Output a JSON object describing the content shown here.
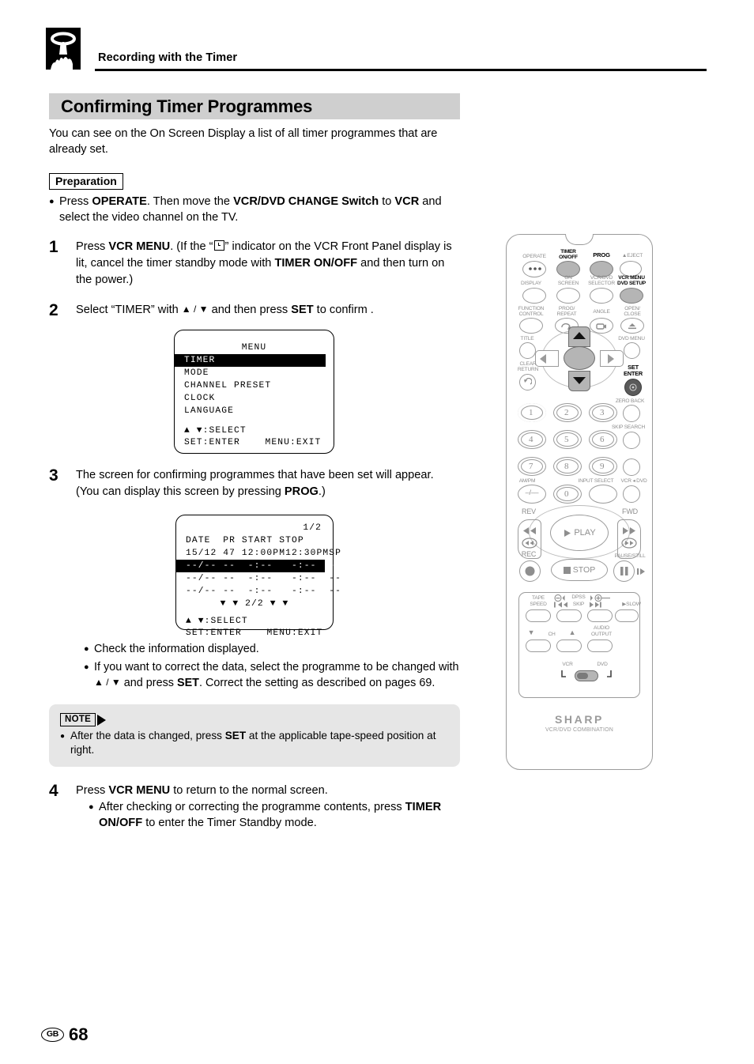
{
  "header": {
    "icon": "finger-press-icon",
    "title": "Recording with the Timer"
  },
  "section": {
    "title": "Confirming Timer Programmes",
    "intro": "You can see on the On Screen Display a list of all timer programmes that are already set."
  },
  "preparation": {
    "label": "Preparation",
    "bullet_prefix": "Press ",
    "bullet_b1": "OPERATE",
    "bullet_mid1": ". Then move the ",
    "bullet_b2": "VCR/DVD CHANGE Switch",
    "bullet_mid2": " to ",
    "bullet_b3": "VCR",
    "bullet_end": " and select the video channel on the TV."
  },
  "steps": [
    {
      "num": "1",
      "p1": "Press ",
      "b1": "VCR MENU",
      "p2": ". (If the “",
      "glyph": "timer-indicator-icon",
      "p3": "” indicator on the VCR Front Panel display is lit, cancel the timer standby mode with ",
      "b2": "TIMER ON/OFF",
      "p4": " and then turn on the power.)"
    },
    {
      "num": "2",
      "p1": "Select “TIMER” with ",
      "arrows": "▲ / ▼",
      "p2": " and then press ",
      "b1": "SET",
      "p3": " to confirm ."
    },
    {
      "num": "3",
      "p1": "The screen for confirming programmes that have been set will appear. (You can display this screen by pressing ",
      "b1": "PROG",
      "p2": ".)"
    },
    {
      "num": "4",
      "p1": "Press ",
      "b1": "VCR MENU",
      "p2": " to return to the normal screen."
    }
  ],
  "osd_menu": {
    "title": "MENU",
    "items": [
      "TIMER",
      "MODE",
      "CHANNEL PRESET",
      "CLOCK",
      "LANGUAGE"
    ],
    "selected_index": 0,
    "hint_select": "▲ ▼:SELECT",
    "hint_enter": "SET:ENTER",
    "hint_exit": "MENU:EXIT"
  },
  "osd_list": {
    "page": "1/2",
    "columns": "DATE  PR START STOP",
    "rows": [
      "15/12 47 12:00PM12:30PMSP",
      "--/-- --  -:--   -:--  --",
      "--/-- --  -:--   -:--  --",
      "--/-- --  -:--   -:--  --"
    ],
    "selected_row_index": 1,
    "pager": "▼ ▼ 2/2 ▼ ▼",
    "hint_select": "▲ ▼:SELECT",
    "hint_enter": "SET:ENTER",
    "hint_exit": "MENU:EXIT"
  },
  "step3_bullets": [
    {
      "text": "Check the information displayed."
    }
  ],
  "step3_bullet2": {
    "p1": "If you want to correct the data, select the programme to be changed with ",
    "arrows": "▲ / ▼",
    "p2": " and press ",
    "b1": "SET",
    "p3": ". Correct the setting as described on pages 69."
  },
  "note": {
    "badge": "NOTE",
    "p1": "After the data is changed, press ",
    "b1": "SET",
    "p2": " at the applicable tape-speed position at right."
  },
  "step4_bullet": {
    "p1": "After checking or correcting the programme contents, press ",
    "b1": "TIMER ON/OFF",
    "p2": " to enter the Timer Standby mode."
  },
  "footer": {
    "region": "GB",
    "page_number": "68"
  },
  "remote": {
    "labels": {
      "operate": "OPERATE",
      "timer_onoff_l1": "TIMER",
      "timer_onoff_l2": "ON/OFF",
      "prog": "PROG",
      "eject": "EJECT",
      "display": "DISPLAY",
      "on_screen_l1": "ON",
      "on_screen_l2": "SCREEN",
      "vcr_dvd_sel_l1": "VCR/DVD",
      "vcr_dvd_sel_l2": "SELECTOR",
      "vcr_menu_l1": "VCR MENU",
      "vcr_menu_l2": "DVD SETUP",
      "function_l1": "FUNCTION",
      "function_l2": "CONTROL",
      "prog_repeat_l1": "PROG/",
      "prog_repeat_l2": "REPEAT",
      "angle": "ANGLE",
      "open_close_l1": "OPEN/",
      "open_close_l2": "CLOSE",
      "title": "TITLE",
      "dvd_menu": "DVD MENU",
      "clear_l1": "CLEAR",
      "clear_l2": "RETURN",
      "set_l1": "SET",
      "set_l2": "ENTER",
      "zero_back": "ZERO BACK",
      "skip_search": "SKIP SEARCH",
      "ampm": "AM/PM",
      "input_select": "INPUT SELECT",
      "vcr_dvd": "VCR ◂ DVD",
      "rev": "REV",
      "fwd": "FWD",
      "play": "PLAY",
      "rec": "REC",
      "stop": "STOP",
      "pause_still": "PAUSE/STILL",
      "tape_l1": "TAPE",
      "tape_l2": "SPEED",
      "dpss": "DPSS",
      "skip": "SKIP",
      "slow": "SLOW",
      "ch": "CH",
      "audio_l1": "AUDIO",
      "audio_l2": "OUTPUT",
      "vcr": "VCR",
      "dvd": "DVD",
      "brand": "SHARP",
      "brand_sub": "VCR/DVD COMBINATION",
      "minus_slash": "–/––"
    },
    "numbers": [
      "1",
      "2",
      "3",
      "4",
      "5",
      "6",
      "7",
      "8",
      "9",
      "0"
    ],
    "highlighted": [
      "timer-onoff",
      "prog",
      "vcr-menu-dvd-setup",
      "dpad-up",
      "dpad-down",
      "dpad-hub",
      "set-enter",
      "vcr-dvd-switch"
    ],
    "colors": {
      "highlight": "#b5b5b5",
      "dark": "#5a5a5a",
      "outline": "#9b9b9b"
    }
  }
}
